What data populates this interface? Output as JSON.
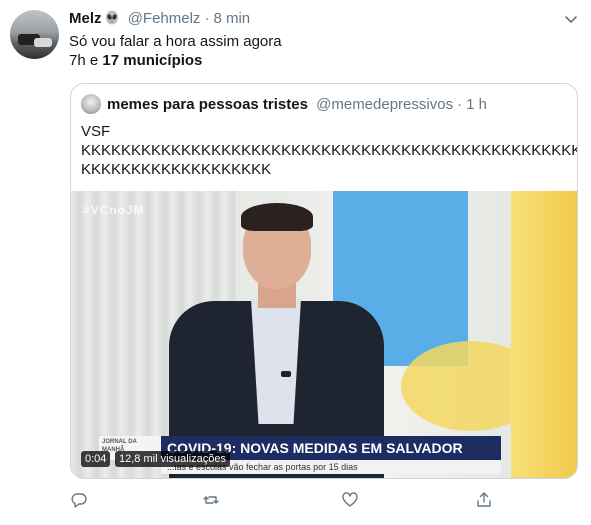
{
  "tweet": {
    "author_name": "Melz",
    "author_handle": "@Fehmelz",
    "separator": "·",
    "time": "8 min",
    "text_line1": "Só vou falar a hora assim agora",
    "text_line2_prefix": "7h e ",
    "text_line2_bold": "17 municípios"
  },
  "quoted_tweet": {
    "author_name": "memes para pessoas tristes",
    "author_handle": "@memedepressivos",
    "separator": "·",
    "time": "1 h",
    "text_line1": "VSF",
    "text_line2": "KKKKKKKKKKKKKKKKKKKKKKKKKKKKKKKKKKKKKKKKKKKKKKKKKKKKKK",
    "text_line3": "KKKKKKKKKKKKKKKKKKK",
    "video": {
      "watermark": "#VCnoJM",
      "logo_text": "JORNAL DA MANHÃ",
      "headline": "COVID-19: NOVAS MEDIDAS EM SALVADOR",
      "subline": "...ias e escolas vão fechar as portas por 15 dias",
      "duration": "0:04",
      "views": "12,8 mil visualizações"
    }
  },
  "actions": {
    "reply_icon": "reply-icon",
    "retweet_icon": "retweet-icon",
    "like_icon": "heart-icon",
    "share_icon": "share-icon"
  },
  "colors": {
    "text": "#14171a",
    "secondary": "#657786",
    "border": "#ccd6dd",
    "headline_bar": "#1d2c61"
  }
}
